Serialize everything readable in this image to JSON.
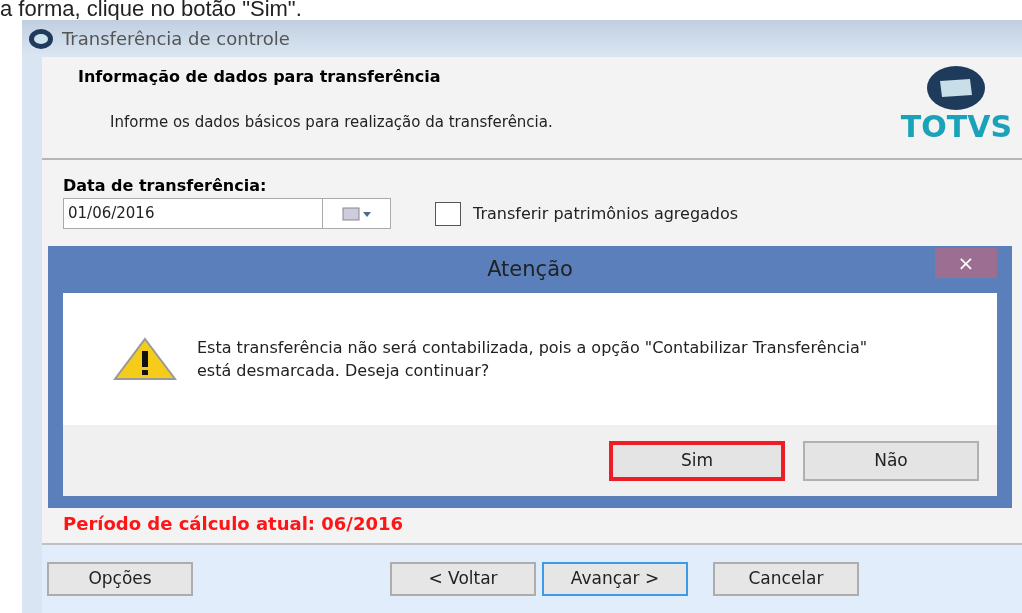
{
  "caption": "a forma, clique no botão \"Sim\".",
  "window": {
    "title": "Transferência de controle"
  },
  "header": {
    "title": "Informação de dados para transferência",
    "subtitle": "Informe os dados básicos para realização da transferência.",
    "logo_text": "TOTVS"
  },
  "form": {
    "date_label": "Data de transferência:",
    "date_value": "01/06/2016",
    "checkbox": {
      "label": "Transferir patrimônios agregados",
      "checked": false
    }
  },
  "period_text": "Período de cálculo atual: 06/2016",
  "footer_buttons": [
    {
      "label": "Opções",
      "default": false
    },
    {
      "label": "< Voltar",
      "default": false
    },
    {
      "label": "Avançar >",
      "default": true
    },
    {
      "label": "Cancelar",
      "default": false
    }
  ],
  "dialog": {
    "title": "Atenção",
    "close": "×",
    "message": "Esta transferência não será contabilizada, pois a opção \"Contabilizar Transferência\" está desmarcada. Deseja continuar?",
    "buttons": [
      {
        "label": "Sim",
        "highlighted": true
      },
      {
        "label": "Não",
        "highlighted": false
      }
    ]
  }
}
